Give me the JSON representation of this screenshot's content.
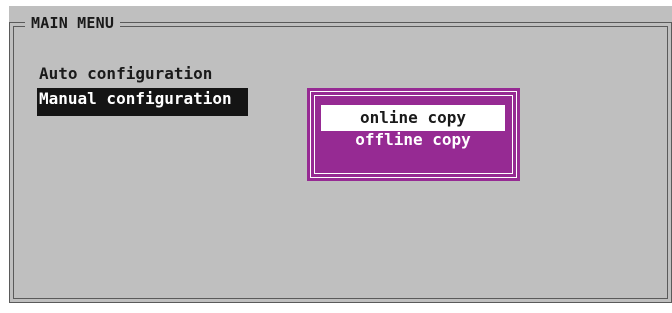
{
  "menu": {
    "title": "MAIN MENU",
    "items": [
      {
        "label": "Auto configuration",
        "selected": false
      },
      {
        "label": "Manual configuration",
        "selected": true
      }
    ]
  },
  "submenu": {
    "options": [
      {
        "label": "online copy",
        "highlighted": true
      },
      {
        "label": "offline copy",
        "highlighted": false
      }
    ]
  },
  "colors": {
    "background": "#bfbfbf",
    "selection": "#141414",
    "popup": "#962a93",
    "highlight": "#ffffff"
  }
}
